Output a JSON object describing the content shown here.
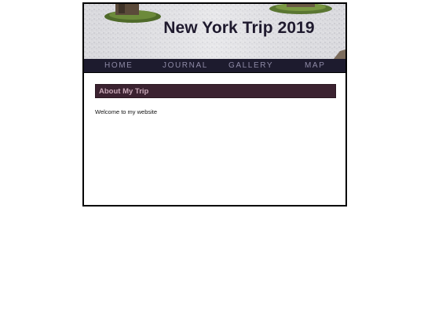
{
  "header": {
    "site_title": "New York Trip 2019"
  },
  "nav": {
    "items": [
      {
        "label": "HOME"
      },
      {
        "label": "JOURNAL"
      },
      {
        "label": "GALLERY"
      },
      {
        "label": "MAP"
      }
    ]
  },
  "main": {
    "section_title": "About My Trip",
    "welcome_text": "Welcome to my website"
  },
  "colors": {
    "nav_background": "#1d1b2e",
    "nav_text": "#8e8aa6",
    "section_header_background": "#3b2230",
    "section_header_text": "#c9a9b8",
    "title_text": "#1f1a2e"
  }
}
